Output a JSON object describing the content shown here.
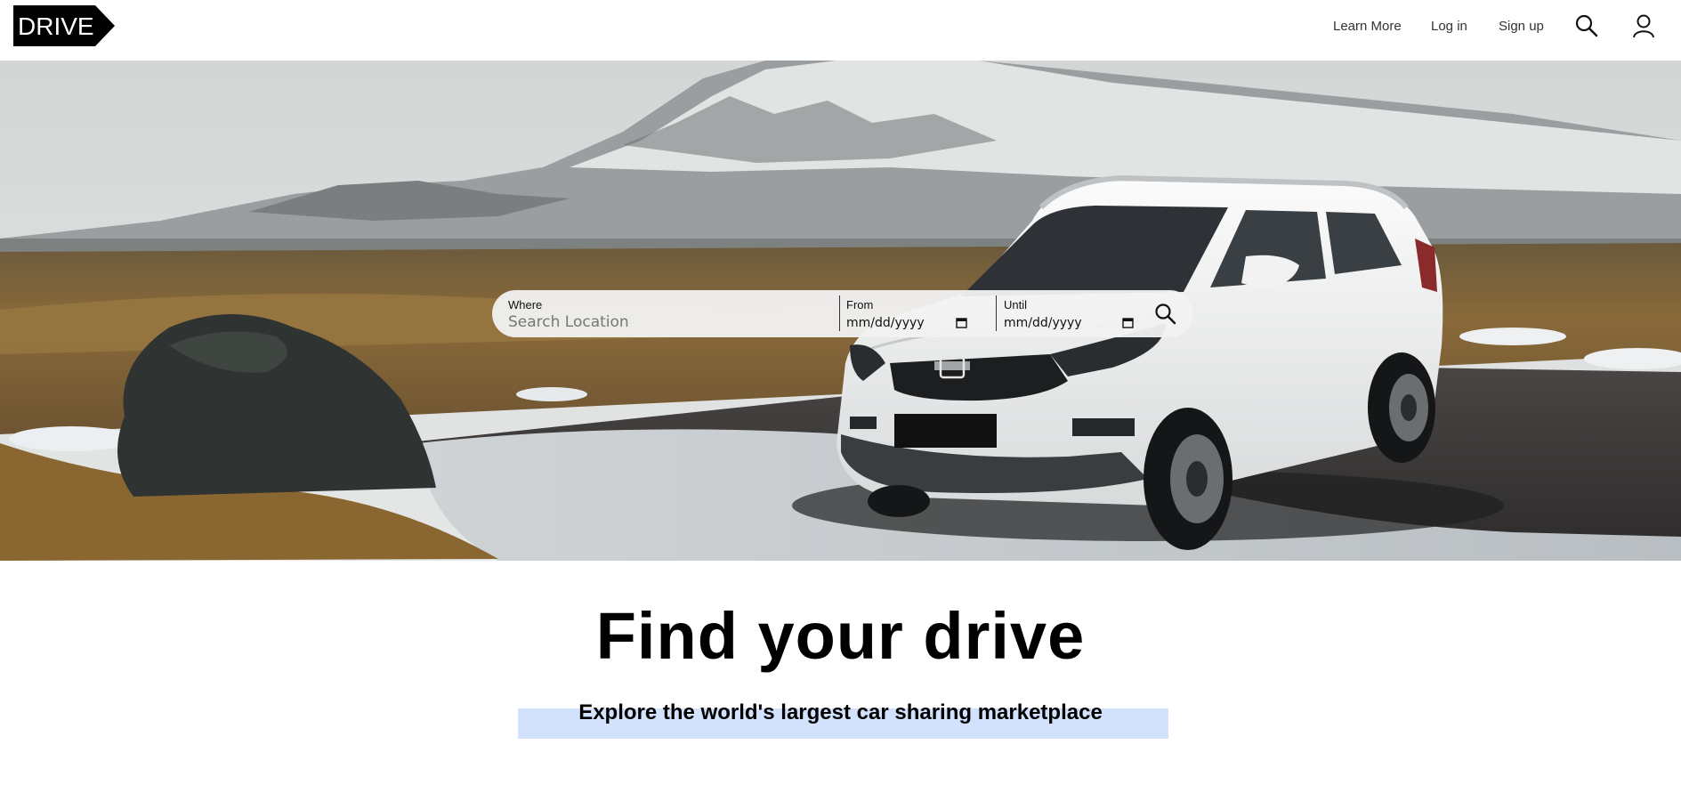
{
  "header": {
    "logo_text": "DRIVE",
    "nav": {
      "learn_more": "Learn More",
      "log_in": "Log in",
      "sign_up": "Sign up"
    },
    "icons": [
      "search-icon",
      "user-icon"
    ]
  },
  "hero": {
    "image_subject": "white SUV parked in snowy volcanic landscape",
    "search": {
      "where_label": "Where",
      "where_placeholder": "Search Location",
      "from_label": "From",
      "from_value": "mm/dd/yyyy",
      "until_label": "Until",
      "until_value": "mm/dd/yyyy"
    }
  },
  "main": {
    "headline": "Find your drive",
    "subheadline": "Explore the world's largest car sharing marketplace"
  },
  "colors": {
    "logo_bg": "#000000",
    "highlight": "#d3e2fc",
    "searchbar_bg": "#f2f2f2"
  }
}
